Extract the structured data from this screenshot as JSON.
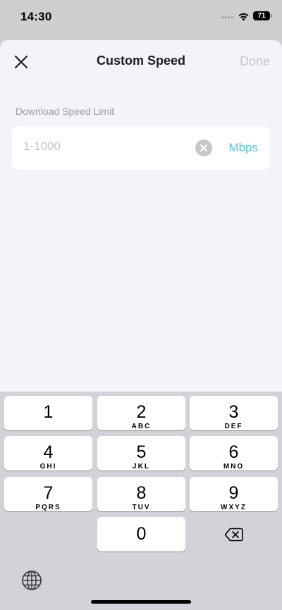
{
  "status_bar": {
    "time": "14:30",
    "battery": "71",
    "icons": [
      "signal-dots-icon",
      "wifi-icon",
      "battery-icon"
    ]
  },
  "header": {
    "title": "Custom Speed",
    "done_label": "Done",
    "close_icon": "close-icon"
  },
  "form": {
    "label": "Download Speed Limit",
    "input": {
      "value": "",
      "placeholder": "1-1000"
    },
    "clear_icon": "clear-icon",
    "unit": "Mbps"
  },
  "keyboard": {
    "keys": [
      {
        "digit": "1",
        "letters": ""
      },
      {
        "digit": "2",
        "letters": "ABC"
      },
      {
        "digit": "3",
        "letters": "DEF"
      },
      {
        "digit": "4",
        "letters": "GHI"
      },
      {
        "digit": "5",
        "letters": "JKL"
      },
      {
        "digit": "6",
        "letters": "MNO"
      },
      {
        "digit": "7",
        "letters": "PQRS"
      },
      {
        "digit": "8",
        "letters": "TUV"
      },
      {
        "digit": "9",
        "letters": "WXYZ"
      },
      {
        "digit": "0",
        "letters": ""
      }
    ],
    "delete_icon": "backspace-icon",
    "globe_icon": "globe-icon"
  },
  "colors": {
    "accent": "#59c3d3",
    "sheet_background": "#f3f4f9",
    "keyboard_background": "#d1d3d9",
    "done_disabled": "#c5c6ca"
  }
}
